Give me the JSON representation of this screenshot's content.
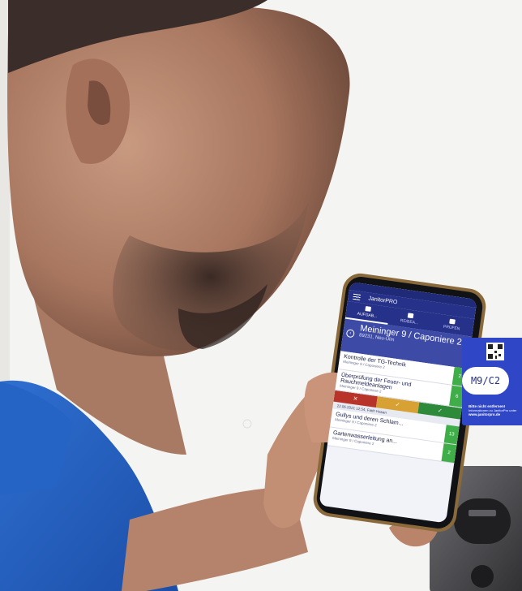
{
  "app": {
    "name": "JanitorPRO",
    "tabs": [
      {
        "label": "AUFGAB..."
      },
      {
        "label": "RE/BEA..."
      },
      {
        "label": "PRÜFEN"
      }
    ],
    "location": {
      "title": "Meininger 9 / Caponiere 2",
      "subtitle": "89231, Neu-Ulm"
    },
    "tasks": [
      {
        "title": "Kontrolle der TG-Technik",
        "sub": "Meininger 9 / Caponiere 2",
        "count": "2"
      },
      {
        "title": "Überprüfung der Feuer- und Rauchmeldeanlagen",
        "sub": "Meininger 9 / Caponiere 2",
        "count": "6"
      },
      {
        "title": "Gullys und deren Schlam...",
        "sub": "Meininger 9 / Caponiere 2",
        "count": "13"
      },
      {
        "title": "Gartenwasserleitung an...",
        "sub": "Meininger 9 / Caponiere 2",
        "count": "2"
      }
    ],
    "actions": {
      "cancel": "✕",
      "maybe": "✓",
      "done": "✓"
    },
    "log": "22.06.2021 12:54, Fatih Hasan"
  },
  "sticker": {
    "code": "M9/C2",
    "note_title": "Bitte nicht entfernen!",
    "note_body": "Informationen zu JanitorPro unter",
    "url": "www.janitorpro.de"
  },
  "colors": {
    "brand_blue": "#26318a",
    "accent_green": "#3fae49",
    "red": "#b8342a",
    "amber": "#d7a233",
    "sticker_blue": "#2f46c6"
  }
}
